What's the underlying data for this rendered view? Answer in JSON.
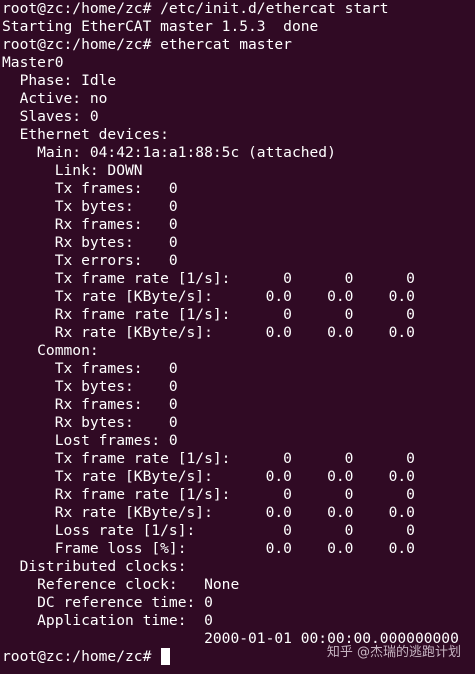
{
  "terminal": {
    "background": "#300a24",
    "foreground": "#ffffff",
    "lines": [
      "root@zc:/home/zc# /etc/init.d/ethercat start",
      "Starting EtherCAT master 1.5.3  done",
      "root@zc:/home/zc# ethercat master",
      "Master0",
      "  Phase: Idle",
      "  Active: no",
      "  Slaves: 0",
      "  Ethernet devices:",
      "    Main: 04:42:1a:a1:88:5c (attached)",
      "      Link: DOWN",
      "      Tx frames:   0",
      "      Tx bytes:    0",
      "      Rx frames:   0",
      "      Rx bytes:    0",
      "      Tx errors:   0",
      "      Tx frame rate [1/s]:      0      0      0",
      "      Tx rate [KByte/s]:      0.0    0.0    0.0",
      "      Rx frame rate [1/s]:      0      0      0",
      "      Rx rate [KByte/s]:      0.0    0.0    0.0",
      "    Common:",
      "      Tx frames:   0",
      "      Tx bytes:    0",
      "      Rx frames:   0",
      "      Rx bytes:    0",
      "      Lost frames: 0",
      "      Tx frame rate [1/s]:      0      0      0",
      "      Tx rate [KByte/s]:      0.0    0.0    0.0",
      "      Rx frame rate [1/s]:      0      0      0",
      "      Rx rate [KByte/s]:      0.0    0.0    0.0",
      "      Loss rate [1/s]:          0      0      0",
      "      Frame loss [%]:         0.0    0.0    0.0",
      "  Distributed clocks:",
      "    Reference clock:   None",
      "    DC reference time: 0",
      "    Application time:  0",
      "                       2000-01-01 00:00:00.000000000"
    ],
    "prompt": "root@zc:/home/zc# "
  },
  "watermark": {
    "text": "知乎 @杰瑞的逃跑计划"
  }
}
